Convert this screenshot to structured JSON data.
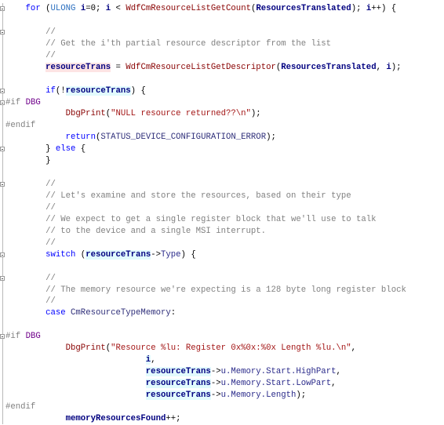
{
  "editor": {
    "colors": {
      "keyword": "#0000ff",
      "function": "#880000",
      "comment": "#808080",
      "string": "#a31515",
      "macro": "#6f008a",
      "variable": "#000080",
      "highlight_definition": "#fde4e4",
      "highlight_reference": "#e2fbfd"
    },
    "lines": [
      {
        "fold": true,
        "tokens": [
          {
            "t": "    "
          },
          {
            "t": "for",
            "c": "kw"
          },
          {
            "t": " ("
          },
          {
            "t": "ULONG",
            "c": "type"
          },
          {
            "t": " "
          },
          {
            "t": "i",
            "c": "var"
          },
          {
            "t": "=0; "
          },
          {
            "t": "i",
            "c": "var"
          },
          {
            "t": " < "
          },
          {
            "t": "WdfCmResourceListGetCount",
            "c": "fn"
          },
          {
            "t": "("
          },
          {
            "t": "ResourcesTranslated",
            "c": "var"
          },
          {
            "t": "); "
          },
          {
            "t": "i",
            "c": "var"
          },
          {
            "t": "++) {"
          }
        ]
      },
      {
        "tokens": []
      },
      {
        "fold": true,
        "tokens": [
          {
            "t": "        "
          },
          {
            "t": "//",
            "c": "cm"
          }
        ]
      },
      {
        "tokens": [
          {
            "t": "        "
          },
          {
            "t": "// Get the i'th partial resource descriptor from the list",
            "c": "cm"
          }
        ]
      },
      {
        "tokens": [
          {
            "t": "        "
          },
          {
            "t": "//",
            "c": "cm"
          }
        ]
      },
      {
        "tokens": [
          {
            "t": "        "
          },
          {
            "t": "resourceTrans",
            "c": "var hl-def"
          },
          {
            "t": " = "
          },
          {
            "t": "WdfCmResourceListGetDescriptor",
            "c": "fn"
          },
          {
            "t": "("
          },
          {
            "t": "ResourcesTranslated",
            "c": "var"
          },
          {
            "t": ", "
          },
          {
            "t": "i",
            "c": "var"
          },
          {
            "t": ");"
          }
        ]
      },
      {
        "tokens": []
      },
      {
        "fold": true,
        "tokens": [
          {
            "t": "        "
          },
          {
            "t": "if",
            "c": "kw"
          },
          {
            "t": "(!"
          },
          {
            "t": "resourceTrans",
            "c": "var hl-ref"
          },
          {
            "t": ") {"
          }
        ]
      },
      {
        "fold": true,
        "tokens": [
          {
            "t": "#if",
            "c": "pp"
          },
          {
            "t": " "
          },
          {
            "t": "DBG",
            "c": "macro"
          }
        ]
      },
      {
        "tokens": [
          {
            "t": "            "
          },
          {
            "t": "DbgPrint",
            "c": "fn"
          },
          {
            "t": "("
          },
          {
            "t": "\"NULL resource returned??\\n\"",
            "c": "str"
          },
          {
            "t": ");"
          }
        ]
      },
      {
        "tokens": [
          {
            "t": "#endif",
            "c": "pp"
          }
        ]
      },
      {
        "tokens": [
          {
            "t": "            "
          },
          {
            "t": "return",
            "c": "kw"
          },
          {
            "t": "("
          },
          {
            "t": "STATUS_DEVICE_CONFIGURATION_ERROR",
            "c": "enum"
          },
          {
            "t": ");"
          }
        ]
      },
      {
        "fold": true,
        "tokens": [
          {
            "t": "        } "
          },
          {
            "t": "else",
            "c": "kw"
          },
          {
            "t": " {"
          }
        ]
      },
      {
        "tokens": [
          {
            "t": "        }"
          }
        ]
      },
      {
        "tokens": []
      },
      {
        "fold": true,
        "tokens": [
          {
            "t": "        "
          },
          {
            "t": "//",
            "c": "cm"
          }
        ]
      },
      {
        "tokens": [
          {
            "t": "        "
          },
          {
            "t": "// Let's examine and store the resources, based on their type",
            "c": "cm"
          }
        ]
      },
      {
        "tokens": [
          {
            "t": "        "
          },
          {
            "t": "//",
            "c": "cm"
          }
        ]
      },
      {
        "tokens": [
          {
            "t": "        "
          },
          {
            "t": "// We expect to get a single register block that we'll use to talk",
            "c": "cm"
          }
        ]
      },
      {
        "tokens": [
          {
            "t": "        "
          },
          {
            "t": "// to the device and a single MSI interrupt.",
            "c": "cm"
          }
        ]
      },
      {
        "tokens": [
          {
            "t": "        "
          },
          {
            "t": "//",
            "c": "cm"
          }
        ]
      },
      {
        "fold": true,
        "tokens": [
          {
            "t": "        "
          },
          {
            "t": "switch",
            "c": "kw"
          },
          {
            "t": " ("
          },
          {
            "t": "resourceTrans",
            "c": "var hl-ref"
          },
          {
            "t": "->"
          },
          {
            "t": "Type",
            "c": "mem"
          },
          {
            "t": ") {"
          }
        ]
      },
      {
        "tokens": []
      },
      {
        "fold": true,
        "tokens": [
          {
            "t": "        "
          },
          {
            "t": "//",
            "c": "cm"
          }
        ]
      },
      {
        "tokens": [
          {
            "t": "        "
          },
          {
            "t": "// The memory resource we're expecting is a 128 byte long register block",
            "c": "cm"
          }
        ]
      },
      {
        "tokens": [
          {
            "t": "        "
          },
          {
            "t": "//",
            "c": "cm"
          }
        ]
      },
      {
        "tokens": [
          {
            "t": "        "
          },
          {
            "t": "case",
            "c": "kw"
          },
          {
            "t": " "
          },
          {
            "t": "CmResourceTypeMemory",
            "c": "enum"
          },
          {
            "t": ":"
          }
        ]
      },
      {
        "tokens": []
      },
      {
        "fold": true,
        "tokens": [
          {
            "t": "#if",
            "c": "pp"
          },
          {
            "t": " "
          },
          {
            "t": "DBG",
            "c": "macro"
          }
        ]
      },
      {
        "tokens": [
          {
            "t": "            "
          },
          {
            "t": "DbgPrint",
            "c": "fn"
          },
          {
            "t": "("
          },
          {
            "t": "\"Resource %lu: Register 0x%0x:%0x Length %lu.\\n\"",
            "c": "str"
          },
          {
            "t": ","
          }
        ]
      },
      {
        "tokens": [
          {
            "t": "                            "
          },
          {
            "t": "i",
            "c": "var hl-ref"
          },
          {
            "t": ","
          }
        ]
      },
      {
        "tokens": [
          {
            "t": "                            "
          },
          {
            "t": "resourceTrans",
            "c": "var hl-ref"
          },
          {
            "t": "->"
          },
          {
            "t": "u.Memory.Start.HighPart",
            "c": "mem"
          },
          {
            "t": ","
          }
        ]
      },
      {
        "tokens": [
          {
            "t": "                            "
          },
          {
            "t": "resourceTrans",
            "c": "var hl-ref"
          },
          {
            "t": "->"
          },
          {
            "t": "u.Memory.Start.LowPart",
            "c": "mem"
          },
          {
            "t": ","
          }
        ]
      },
      {
        "tokens": [
          {
            "t": "                            "
          },
          {
            "t": "resourceTrans",
            "c": "var hl-ref"
          },
          {
            "t": "->"
          },
          {
            "t": "u.Memory.Length",
            "c": "mem"
          },
          {
            "t": ");"
          }
        ]
      },
      {
        "tokens": [
          {
            "t": "#endif",
            "c": "pp"
          }
        ]
      },
      {
        "tokens": [
          {
            "t": "            "
          },
          {
            "t": "memoryResourcesFound",
            "c": "var"
          },
          {
            "t": "++;"
          }
        ]
      }
    ]
  }
}
